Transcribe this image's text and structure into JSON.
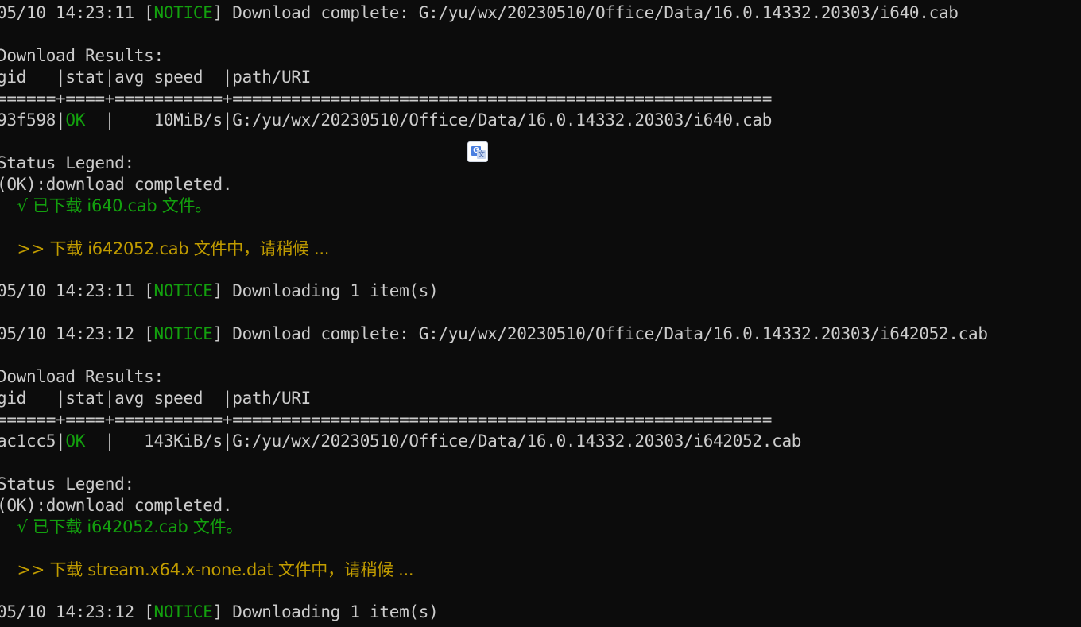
{
  "block1": {
    "notice_complete": {
      "timestamp": "05/10 14:23:11 ",
      "bracket_open": "[",
      "level": "NOTICE",
      "bracket_close": "]",
      "message": " Download complete: G:/yu/wx/20230510/Office/Data/16.0.14332.20303/i640.cab"
    },
    "results_title": "Download Results:",
    "header": "gid   |stat|avg speed  |path/URI",
    "separator": "======+====+===========+=======================================================",
    "row": {
      "gid": "93f598|",
      "stat": "OK",
      "speed": "  |    10MiB/s|",
      "path": "G:/yu/wx/20230510/Office/Data/16.0.14332.20303/i640.cab"
    },
    "legend_title": "Status Legend:",
    "legend_ok": "(OK):download completed.",
    "done_msg": "    √ 已下载 i640.cab 文件。",
    "next_msg": "    >> 下载 i642052.cab 文件中，请稍候 ...",
    "notice_downloading": {
      "timestamp": "05/10 14:23:11 ",
      "level": "NOTICE",
      "message": " Downloading 1 item(s)"
    }
  },
  "block2": {
    "notice_complete": {
      "timestamp": "05/10 14:23:12 ",
      "level": "NOTICE",
      "message": " Download complete: G:/yu/wx/20230510/Office/Data/16.0.14332.20303/i642052.cab"
    },
    "results_title": "Download Results:",
    "header": "gid   |stat|avg speed  |path/URI",
    "separator": "======+====+===========+=======================================================",
    "row": {
      "gid": "ac1cc5|",
      "stat": "OK",
      "speed": "  |   143KiB/s|",
      "path": "G:/yu/wx/20230510/Office/Data/16.0.14332.20303/i642052.cab"
    },
    "legend_title": "Status Legend:",
    "legend_ok": "(OK):download completed.",
    "done_msg": "    √ 已下载 i642052.cab 文件。",
    "next_msg": "    >> 下载 stream.x64.x-none.dat 文件中，请稍候 ...",
    "notice_downloading": {
      "timestamp": "05/10 14:23:12 ",
      "level": "NOTICE",
      "message": " Downloading 1 item(s)"
    }
  },
  "translate_icon": {
    "name": "translate-icon",
    "g_letter": "G",
    "x_letter": "文"
  },
  "colors": {
    "background": "#0c0c0c",
    "text": "#cccccc",
    "green": "#13a10e",
    "yellow": "#c19c00"
  }
}
